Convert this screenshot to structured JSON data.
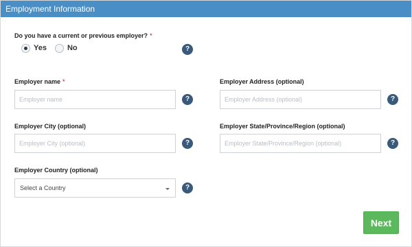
{
  "header": {
    "title": "Employment Information"
  },
  "current_employer": {
    "question": "Do you have a current or previous employer?",
    "required_mark": "*",
    "options": [
      {
        "label": "Yes",
        "selected": true
      },
      {
        "label": "No",
        "selected": false
      }
    ]
  },
  "employer_name": {
    "label": "Employer name",
    "required_mark": "*",
    "placeholder": "Employer name",
    "value": ""
  },
  "employer_address": {
    "label": "Employer Address (optional)",
    "placeholder": "Employer Address (optional)",
    "value": ""
  },
  "employer_city": {
    "label": "Employer City (optional)",
    "placeholder": "Employer City (optional)",
    "value": ""
  },
  "employer_state": {
    "label": "Employer State/Province/Region (optional)",
    "placeholder": "Employer State/Province/Region (optional)",
    "value": ""
  },
  "employer_country": {
    "label": "Employer Country (optional)",
    "selected": "Select a Country"
  },
  "help_icon": {
    "glyph": "?",
    "color": "#3a5a7c"
  },
  "actions": {
    "next_label": "Next",
    "next_color": "#5cb85c"
  },
  "colors": {
    "header_bg": "#4a8ec6"
  }
}
